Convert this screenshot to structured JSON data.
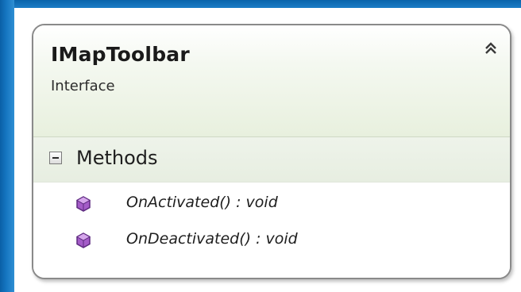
{
  "class": {
    "name": "IMapToolbar",
    "stereotype": "Interface",
    "collapse_icon": "double-chevron-up-icon"
  },
  "sections": [
    {
      "label": "Methods",
      "toggle_icon": "collapse-minus-icon",
      "members": [
        {
          "signature": "OnActivated() : void",
          "icon": "method-cube-icon"
        },
        {
          "signature": "OnDeactivated() : void",
          "icon": "method-cube-icon"
        }
      ]
    }
  ],
  "colors": {
    "method_icon": "#8b3fb5",
    "border": "#8a8a8a",
    "background_accent": "#1677c2"
  }
}
